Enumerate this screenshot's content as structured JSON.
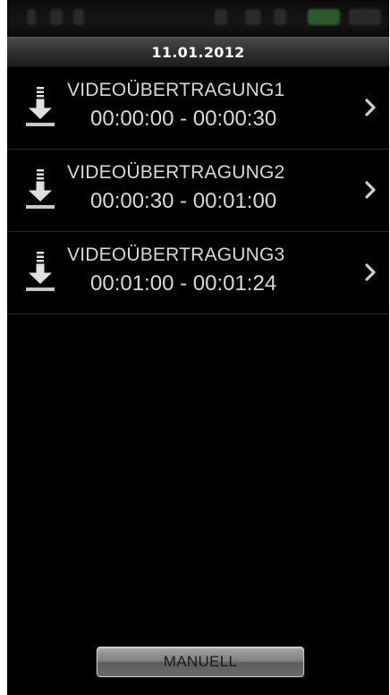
{
  "header": {
    "date": "11.01.2012"
  },
  "recordings": [
    {
      "title": "VIDEOÜBERTRAGUNG1",
      "time_range": "00:00:00 - 00:00:30",
      "icon": "download-icon"
    },
    {
      "title": "VIDEOÜBERTRAGUNG2",
      "time_range": "00:00:30 - 00:01:00",
      "icon": "download-icon"
    },
    {
      "title": "VIDEOÜBERTRAGUNG3",
      "time_range": "00:01:00 - 00:01:24",
      "icon": "download-icon"
    }
  ],
  "footer": {
    "manual_label": "MANUELL"
  },
  "colors": {
    "background": "#000000",
    "text": "#d8d8d8",
    "header_text": "#ffffff",
    "button_text": "#1a1a1a"
  }
}
